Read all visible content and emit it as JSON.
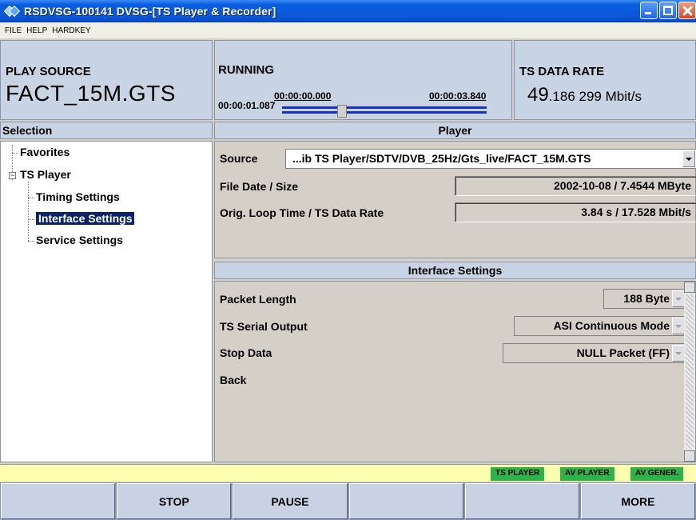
{
  "window": {
    "title": "RSDVSG-100141  DVSG-[TS Player & Recorder]"
  },
  "menu": [
    "FILE",
    "HELP",
    "HARDKEY"
  ],
  "header": {
    "play_source_label": "PLAY SOURCE",
    "play_source_file": "FACT_15M.GTS",
    "running_label": "RUNNING",
    "current_time": "00:00:01.087",
    "start_time": "00:00:00.000",
    "end_time": "00:00:03.840",
    "progress_fraction": 0.283,
    "data_rate_label": "TS DATA RATE",
    "data_rate_big": "49",
    "data_rate_small": ".186 299 Mbit/s"
  },
  "selection": {
    "header": "Selection",
    "items": [
      "Favorites",
      "TS Player",
      "Timing Settings",
      "Interface Settings",
      "Service Settings"
    ],
    "selected": "Interface Settings"
  },
  "player": {
    "header": "Player",
    "source_label": "Source",
    "source_value": "...ib TS Player/SDTV/DVB_25Hz/Gts_live/FACT_15M.GTS",
    "file_date_label": "File Date / Size",
    "file_date_value": "2002-10-08 / 7.4544 MByte",
    "loop_label": "Orig. Loop Time / TS Data Rate",
    "loop_value": "3.84 s / 17.528 Mbit/s"
  },
  "interface": {
    "header": "Interface Settings",
    "packet_length_label": "Packet Length",
    "packet_length_value": "188 Byte",
    "serial_output_label": "TS Serial Output",
    "serial_output_value": "ASI Continuous Mode",
    "stop_data_label": "Stop Data",
    "stop_data_value": "NULL Packet (FF)",
    "back_label": "Back"
  },
  "status_tags": [
    {
      "label": "TS PLAYER",
      "color": "#2db34a"
    },
    {
      "label": "AV PLAYER",
      "color": "#2db34a"
    },
    {
      "label": "AV GENER.",
      "color": "#2db34a"
    }
  ],
  "softkeys": [
    "",
    "STOP",
    "PAUSE",
    "",
    "",
    "MORE"
  ]
}
